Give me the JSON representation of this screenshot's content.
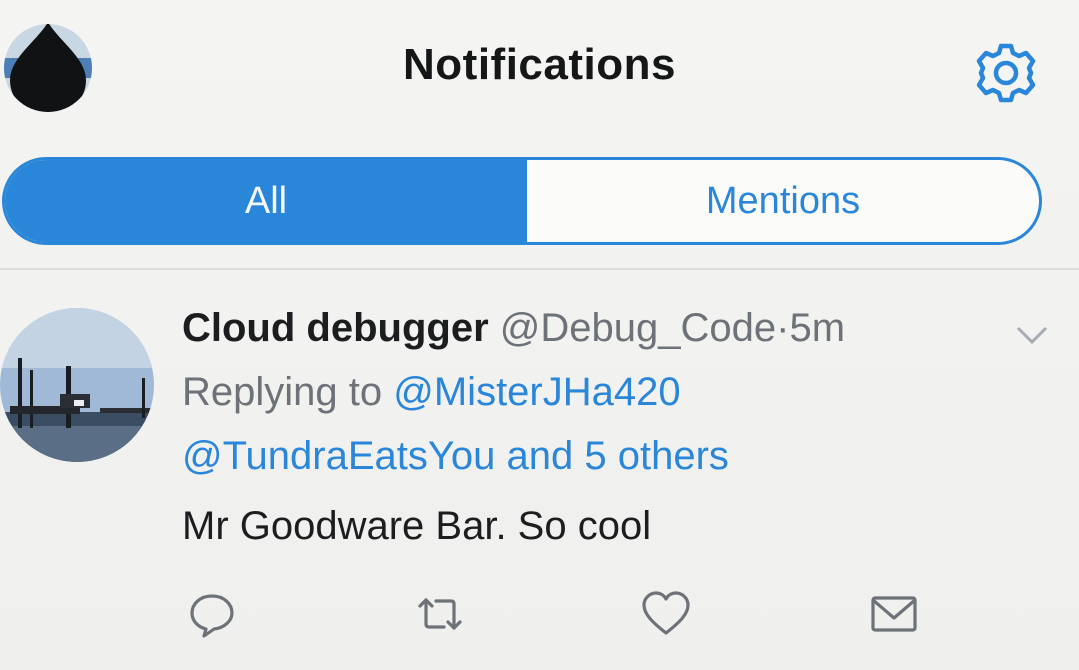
{
  "header": {
    "title": "Notifications",
    "avatar_icon": "profile-avatar-icon",
    "settings_icon": "gear-icon"
  },
  "tabs": [
    {
      "label": "All",
      "selected": true
    },
    {
      "label": "Mentions",
      "selected": false
    }
  ],
  "tweet": {
    "display_name": "Cloud debugger",
    "handle": "@Debug_Code",
    "separator": "·",
    "time": "5m",
    "replying_prefix": "Replying to",
    "reply_user_1": "@MisterJHa420",
    "reply_user_2": "@TundraEatsYou",
    "reply_suffix": "and 5 others",
    "text": "Mr Goodware Bar. So cool",
    "actions": [
      {
        "icon": "reply-icon"
      },
      {
        "icon": "retweet-icon"
      },
      {
        "icon": "like-icon"
      },
      {
        "icon": "share-icon"
      }
    ]
  },
  "colors": {
    "accent": "#2a86d9",
    "text_primary": "#1b1d1f",
    "text_secondary": "#6d7278",
    "background": "#f3f3f1"
  }
}
